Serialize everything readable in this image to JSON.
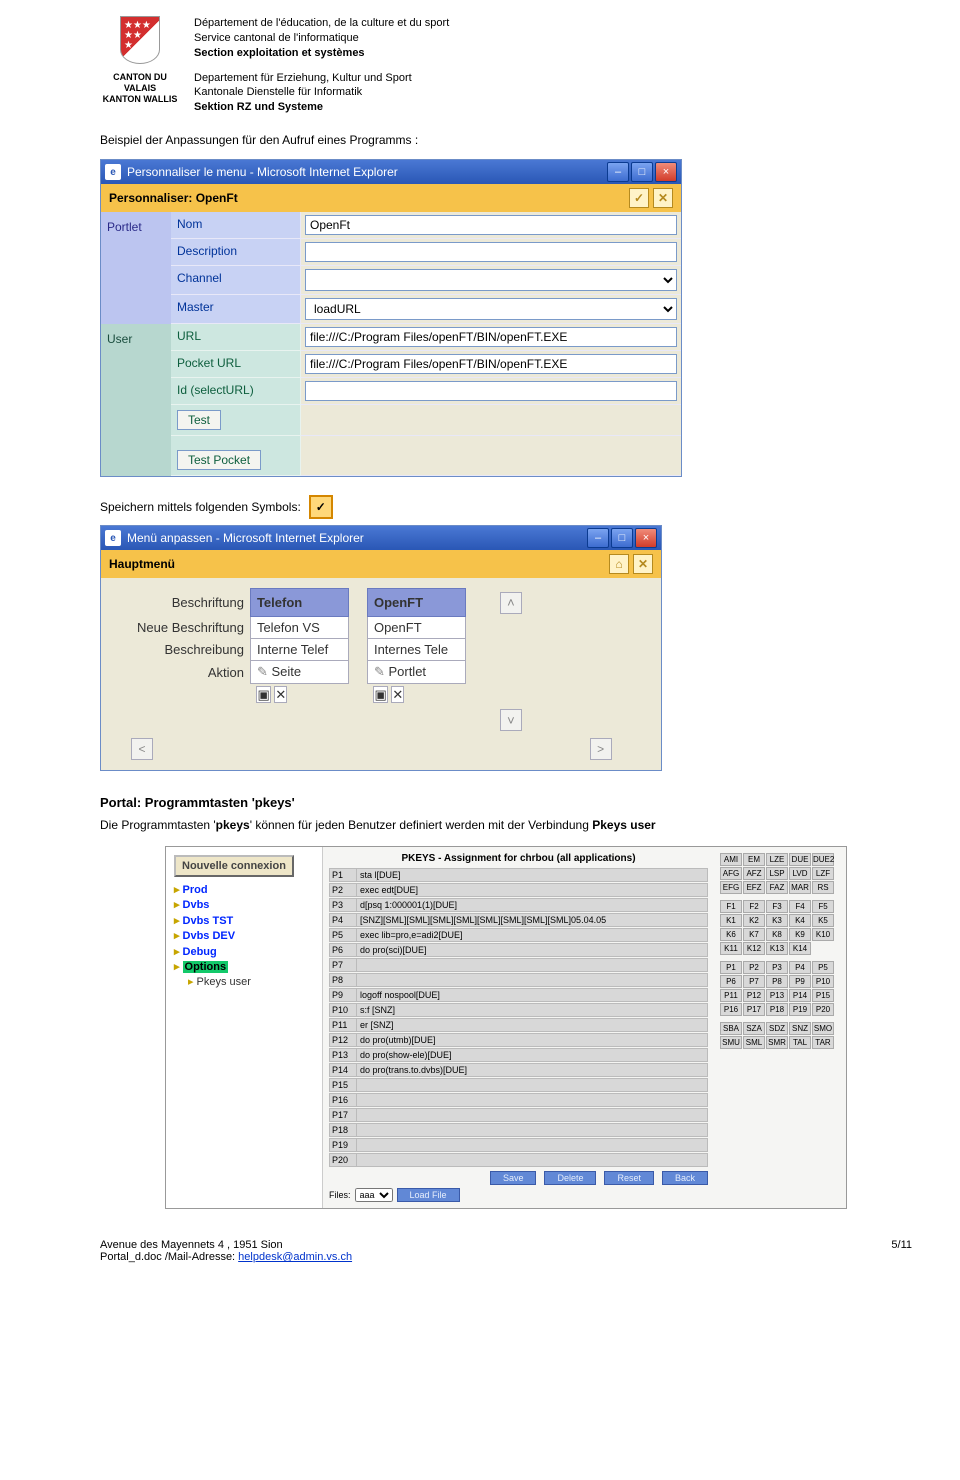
{
  "header": {
    "canton_fr": "CANTON DU VALAIS",
    "canton_de": "KANTON WALLIS",
    "dept_fr1": "Département de l'éducation, de la culture et du sport",
    "dept_fr2": "Service cantonal de l'informatique",
    "dept_fr3": "Section exploitation et systèmes",
    "dept_de1": "Departement für Erziehung, Kultur und Sport",
    "dept_de2": "Kantonale Dienstelle für Informatik",
    "dept_de3": "Sektion RZ und Systeme"
  },
  "intro": "Beispiel der Anpassungen für den Aufruf eines Programms :",
  "win1": {
    "title": "Personnaliser le menu - Microsoft Internet Explorer",
    "bar": "Personnaliser: OpenFt",
    "portlet": "Portlet",
    "user": "User",
    "rows": {
      "nom_l": "Nom",
      "nom_v": "OpenFt",
      "desc_l": "Description",
      "desc_v": "",
      "chan_l": "Channel",
      "chan_v": "",
      "mast_l": "Master",
      "mast_v": "loadURL",
      "url_l": "URL",
      "url_v": "file:///C:/Program Files/openFT/BIN/openFT.EXE",
      "purl_l": "Pocket URL",
      "purl_v": "file:///C:/Program Files/openFT/BIN/openFT.EXE",
      "id_l": "Id (selectURL)",
      "id_v": ""
    },
    "test": "Test",
    "testp": "Test Pocket"
  },
  "save_line": "Speichern mittels folgenden Symbols:",
  "win2": {
    "title": "Menü anpassen - Microsoft Internet Explorer",
    "bar": "Hauptmenü",
    "r1": "Beschriftung",
    "r1a": "Telefon",
    "r1b": "OpenFT",
    "r2": "Neue Beschriftung",
    "r2a": "Telefon VS",
    "r2b": "OpenFT",
    "r3": "Beschreibung",
    "r3a": "Interne Telef",
    "r3b": "Internes Tele",
    "r4": "Aktion",
    "r4a": "Seite",
    "r4b": "Portlet"
  },
  "section": {
    "title": "Portal: Programmtasten 'pkeys'",
    "body1": "Die Programmtasten '",
    "body_b": "pkeys",
    "body2": "' können für jeden Benutzer definiert werden mit der Verbindung ",
    "body_b2": "Pkeys user"
  },
  "pk": {
    "newconn": "Nouvelle connexion",
    "tree": [
      "Prod",
      "Dvbs",
      "Dvbs TST",
      "Dvbs DEV",
      "Debug",
      "Options",
      "Pkeys user"
    ],
    "title": "PKEYS - Assignment for chrbou (all applications)",
    "rows": [
      {
        "k": "P1",
        "v": "sta l[DUE]"
      },
      {
        "k": "P2",
        "v": "exec edt[DUE]"
      },
      {
        "k": "P3",
        "v": "d[psq 1:000001(1)[DUE]"
      },
      {
        "k": "P4",
        "v": "[SNZ][SML][SML][SML][SML][SML][SML][SML][SML]05.04.05"
      },
      {
        "k": "P5",
        "v": "exec lib=pro,e=adi2[DUE]"
      },
      {
        "k": "P6",
        "v": "do pro(sci)[DUE]"
      },
      {
        "k": "P7",
        "v": ""
      },
      {
        "k": "P8",
        "v": ""
      },
      {
        "k": "P9",
        "v": "logoff nospool[DUE]"
      },
      {
        "k": "P10",
        "v": "s:f      [SNZ]"
      },
      {
        "k": "P11",
        "v": "er        [SNZ]"
      },
      {
        "k": "P12",
        "v": "do pro(utmb)[DUE]"
      },
      {
        "k": "P13",
        "v": "do pro(show-ele)[DUE]"
      },
      {
        "k": "P14",
        "v": "do pro(trans.to.dvbs)[DUE]"
      },
      {
        "k": "P15",
        "v": ""
      },
      {
        "k": "P16",
        "v": ""
      },
      {
        "k": "P17",
        "v": ""
      },
      {
        "k": "P18",
        "v": ""
      },
      {
        "k": "P19",
        "v": ""
      },
      {
        "k": "P20",
        "v": ""
      }
    ],
    "grids": [
      [
        "AMI",
        "EM",
        "LZE",
        "DUE",
        "DUE2",
        "AFG",
        "AFZ",
        "LSP",
        "LVD",
        "LZF",
        "EFG",
        "EFZ",
        "FAZ",
        "MAR",
        "RS"
      ],
      [
        "F1",
        "F2",
        "F3",
        "F4",
        "F5",
        "K1",
        "K2",
        "K3",
        "K4",
        "K5",
        "K6",
        "K7",
        "K8",
        "K9",
        "K10",
        "K11",
        "K12",
        "K13",
        "K14",
        ""
      ],
      [
        "P1",
        "P2",
        "P3",
        "P4",
        "P5",
        "P6",
        "P7",
        "P8",
        "P9",
        "P10",
        "P11",
        "P12",
        "P13",
        "P14",
        "P15",
        "P16",
        "P17",
        "P18",
        "P19",
        "P20"
      ],
      [
        "SBA",
        "SZA",
        "SDZ",
        "SNZ",
        "SMO",
        "SMU",
        "SML",
        "SMR",
        "TAL",
        "TAR",
        "",
        "",
        "",
        "",
        ""
      ]
    ],
    "btns": {
      "save": "Save",
      "delete": "Delete",
      "reset": "Reset",
      "back": "Back",
      "files": "Files:",
      "file_sel": "aaa",
      "load": "Load File"
    }
  },
  "footer": {
    "addr": "Avenue des Mayennets 4 , 1951 Sion",
    "doc": "Portal_d.doc /Mail-Adresse: ",
    "mail": "helpdesk@admin.vs.ch",
    "page": "5/11"
  }
}
